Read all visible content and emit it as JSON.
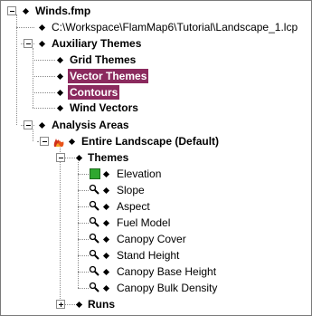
{
  "tree": {
    "root": {
      "label": "Winds.fmp"
    },
    "landscape_path": {
      "label": "C:\\Workspace\\FlamMap6\\Tutorial\\Landscape_1.lcp"
    },
    "auxiliary": {
      "label": "Auxiliary Themes",
      "children": [
        {
          "label": "Grid Themes",
          "selected": false
        },
        {
          "label": "Vector Themes",
          "selected": true
        },
        {
          "label": "Contours",
          "selected": true
        },
        {
          "label": "Wind Vectors",
          "selected": false
        }
      ]
    },
    "analysis": {
      "label": "Analysis Areas",
      "landscape": {
        "label": "Entire Landscape (Default)",
        "icon": "fire-icon",
        "themes": {
          "label": "Themes",
          "items": [
            {
              "label": "Elevation",
              "icon": "green-square-icon"
            },
            {
              "label": "Slope",
              "icon": "magnifier-icon"
            },
            {
              "label": "Aspect",
              "icon": "magnifier-icon"
            },
            {
              "label": "Fuel Model",
              "icon": "magnifier-icon"
            },
            {
              "label": "Canopy Cover",
              "icon": "magnifier-icon"
            },
            {
              "label": "Stand Height",
              "icon": "magnifier-icon"
            },
            {
              "label": "Canopy Base Height",
              "icon": "magnifier-icon"
            },
            {
              "label": "Canopy Bulk Density",
              "icon": "magnifier-icon"
            }
          ]
        },
        "runs": {
          "label": "Runs"
        }
      }
    }
  },
  "colors": {
    "selection": "#8b2a5e",
    "elevation": "#2fa82f"
  }
}
